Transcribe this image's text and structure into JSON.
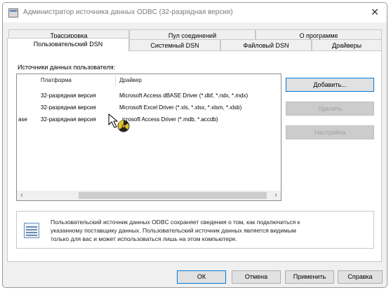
{
  "window": {
    "title": "Администратор источника данных ODBC (32-разрядная версия)",
    "close_glyph": "✕"
  },
  "tabs_row1": [
    "Трассировка",
    "Пул соединений",
    "О программе"
  ],
  "tabs_row2": [
    "Пользовательский DSN",
    "Системный DSN",
    "Файловый DSN",
    "Драйверы"
  ],
  "active_tab": "Пользовательский DSN",
  "user_dsn": {
    "group_label": "Источники данных пользователя:",
    "columns": [
      "Платформа",
      "Драйвер"
    ],
    "rows": [
      {
        "prefix": "",
        "platform": "32-разрядная версия",
        "driver": "Microsoft Access dBASE Driver (*.dbf, *.ndx, *.mdx)"
      },
      {
        "prefix": "",
        "platform": "32-разрядная версия",
        "driver": "Microsoft Excel Driver (*.xls, *.xlsx, *.xlsm, *.xlsb)"
      },
      {
        "prefix": "ase",
        "platform": "32-разрядная версия",
        "driver": "icrosoft Access Driver (*.mdb, *.accdb)"
      }
    ],
    "scroll_left": "‹",
    "scroll_right": "›"
  },
  "side_buttons": {
    "add": "Добавить...",
    "remove": "Удалить",
    "configure": "Настройка"
  },
  "info": {
    "lines": [
      "Пользовательский источник данных ODBC сохраняет сведения о том, как подключиться к",
      "указанному поставщику данных.   Пользовательский источник данных является видимым",
      "только для вас и может использоваться лишь на этом компьютере."
    ],
    "icon": "data-source-icon"
  },
  "footer": {
    "ok": "ОК",
    "cancel": "Отмена",
    "apply": "Применить",
    "help": "Справка"
  },
  "colors": {
    "accent": "#0078d7",
    "window_bg": "#f0f0f0",
    "disabled_text": "#a0a0a0"
  }
}
